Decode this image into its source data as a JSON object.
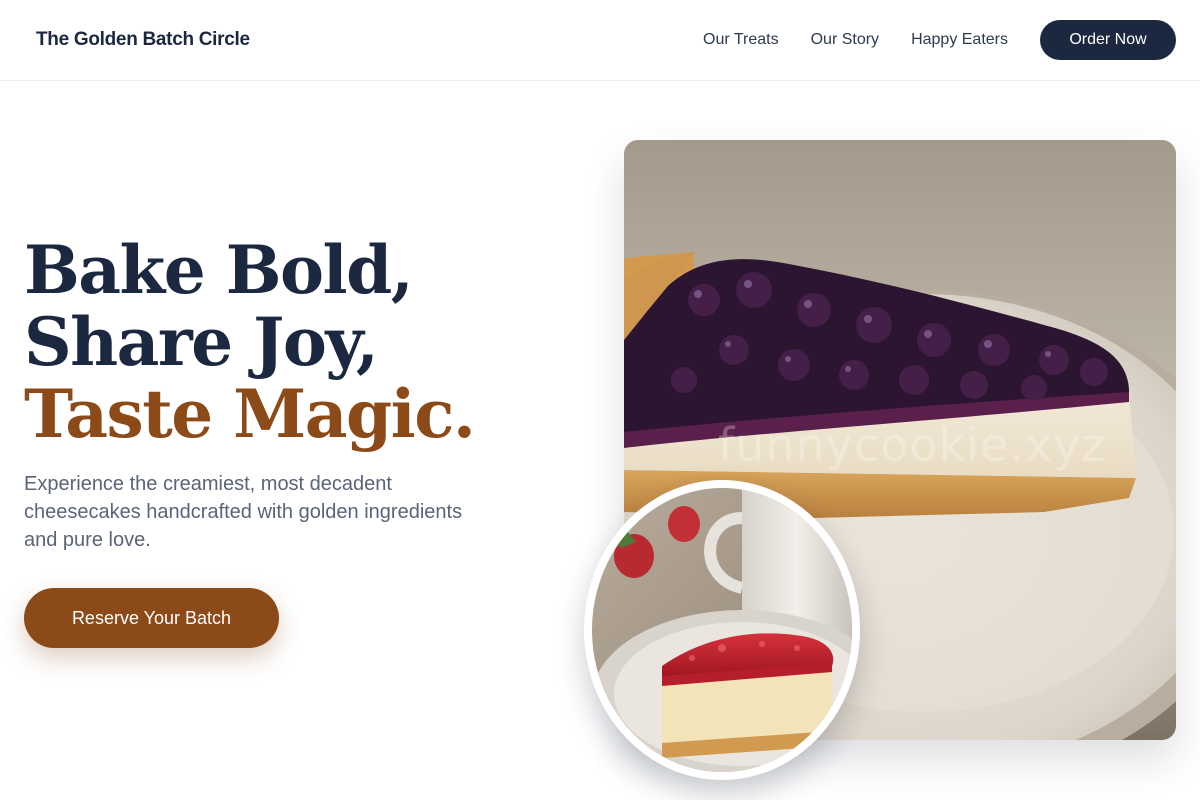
{
  "header": {
    "brand": "The Golden Batch Circle",
    "nav": [
      "Our Treats",
      "Our Story",
      "Happy Eaters"
    ],
    "order_label": "Order Now"
  },
  "hero": {
    "headline_line1": "Bake Bold,",
    "headline_line2": "Share Joy,",
    "headline_line3": "Taste Magic.",
    "description": "Experience the creamiest, most decadent cheesecakes handcrafted with golden ingredients and pure love.",
    "cta_label": "Reserve Your Batch"
  },
  "media": {
    "main_photo": "blueberry-cheesecake-slice",
    "main_watermark": "funnycookie.xyz",
    "inset_photo": "strawberry-cheesecake-slice-with-mug"
  },
  "colors": {
    "navy": "#1c2840",
    "accent_brown": "#8c4a18",
    "body_text": "#5a6478"
  }
}
